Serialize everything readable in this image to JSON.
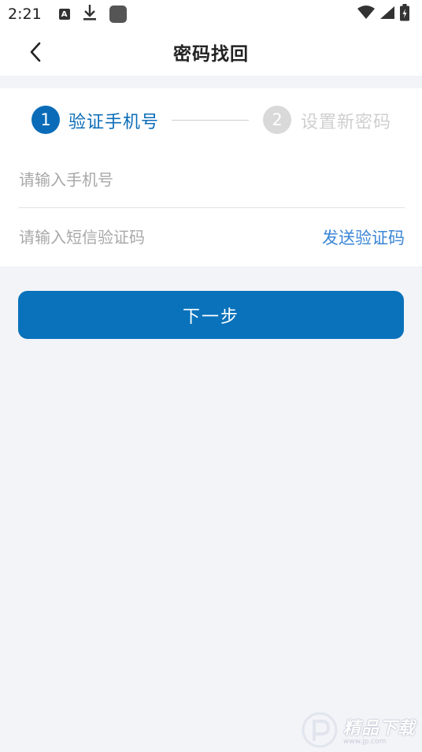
{
  "status_bar": {
    "time": "2:21",
    "icons": [
      "a-icon",
      "download-icon",
      "app-square-icon",
      "wifi-icon",
      "signal-icon",
      "battery-icon"
    ]
  },
  "header": {
    "title": "密码找回"
  },
  "steps": [
    {
      "number": "1",
      "label": "验证手机号",
      "active": true
    },
    {
      "number": "2",
      "label": "设置新密码",
      "active": false
    }
  ],
  "form": {
    "phone_placeholder": "请输入手机号",
    "phone_value": "",
    "code_placeholder": "请输入短信验证码",
    "code_value": "",
    "send_code_label": "发送验证码"
  },
  "next_button": {
    "label": "下一步"
  },
  "watermark": {
    "title": "精品下载",
    "url": "www.jp.com"
  },
  "colors": {
    "primary": "#0a72bb",
    "link": "#3a86d6",
    "inactive": "#d9d9d9",
    "background": "#f3f4f8"
  }
}
